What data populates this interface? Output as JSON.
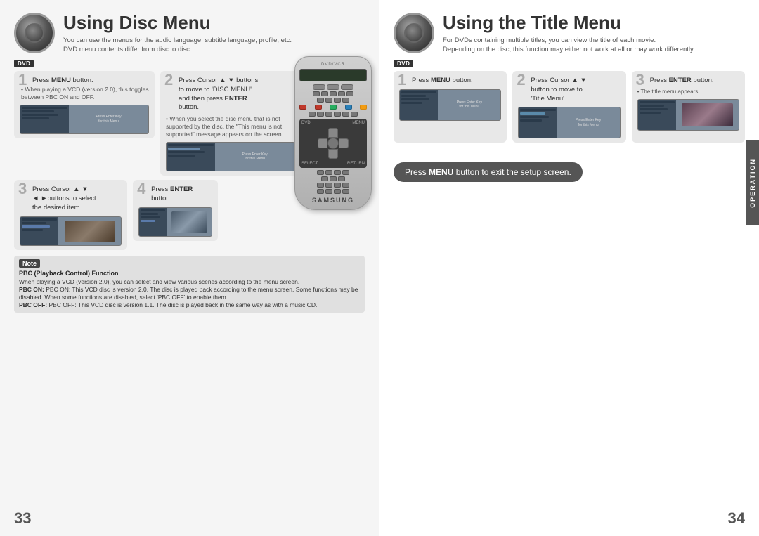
{
  "left_page": {
    "title": "Using Disc Menu",
    "subtitle1": "You can use the menus for the audio language, subtitle language, profile, etc.",
    "subtitle2": "DVD menu contents differ from disc to disc.",
    "dvd_badge": "DVD",
    "step1": {
      "number": "1",
      "text": "Press MENU button.",
      "bold_words": [
        "MENU"
      ]
    },
    "step2": {
      "number": "2",
      "text": "Press Cursor ▲ ▼ buttons to move to 'DISC MENU' and then press ENTER button.",
      "note": "When you select the disc menu that is not supported by the disc, the \"This menu is not supported\" message appears on the screen."
    },
    "step1_bullet": "When playing a VCD (version 2.0), this toggles between PBC ON and OFF.",
    "step3": {
      "number": "3",
      "text": "Press Cursor ▲ ▼ ◄ ►buttons to select the desired item."
    },
    "step4": {
      "number": "4",
      "text": "Press ENTER button.",
      "bold_words": [
        "ENTER"
      ]
    },
    "note": {
      "label": "Note",
      "title": "PBC (Playback Control) Function",
      "lines": [
        "When playing a VCD (version 2.0), you can select and view various scenes according to the menu screen.",
        "PBC ON: This VCD disc is version 2.0. The disc is played back according to the menu screen. Some functions may be disabled. When some functions are disabled, select 'PBC OFF' to enable them.",
        "PBC OFF: This VCD disc is version 1.1. The disc is played back in the same way as with a music CD."
      ]
    },
    "page_number": "33"
  },
  "right_page": {
    "title": "Using the Title Menu",
    "subtitle1": "For DVDs containing multiple titles, you can view the title of each movie.",
    "subtitle2": "Depending on the disc, this function may either not work at all or may work differently.",
    "dvd_badge": "DVD",
    "step1": {
      "number": "1",
      "text": "Press MENU button."
    },
    "step2": {
      "number": "2",
      "text": "Press Cursor ▲ ▼ button to move to 'Title Menu'."
    },
    "step3": {
      "number": "3",
      "text": "Press ENTER button."
    },
    "step3_note": "The title menu appears.",
    "press_menu": "Press MENU button to exit the setup screen.",
    "operation_label": "OPERATION",
    "page_number": "34"
  }
}
